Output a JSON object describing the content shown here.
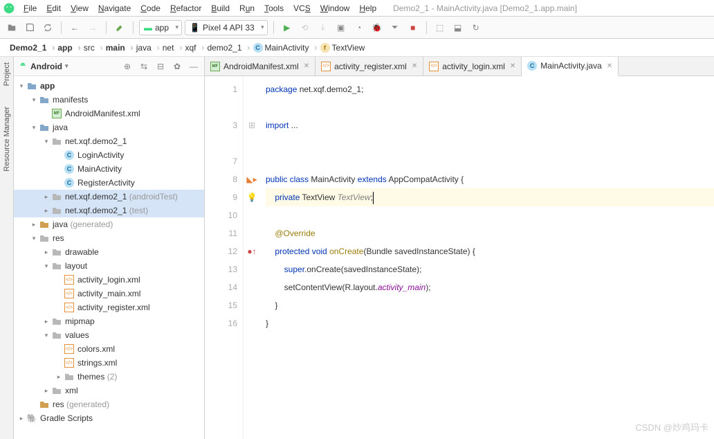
{
  "window_title": "Demo2_1 - MainActivity.java [Demo2_1.app.main]",
  "menu": [
    "File",
    "Edit",
    "View",
    "Navigate",
    "Code",
    "Refactor",
    "Build",
    "Run",
    "Tools",
    "VCS",
    "Window",
    "Help"
  ],
  "toolbar": {
    "module": "app",
    "device": "Pixel 4 API 33"
  },
  "breadcrumb": [
    {
      "label": "Demo2_1",
      "bold": true
    },
    {
      "label": "app",
      "bold": true
    },
    {
      "label": "src"
    },
    {
      "label": "main",
      "bold": true
    },
    {
      "label": "java"
    },
    {
      "label": "net"
    },
    {
      "label": "xqf"
    },
    {
      "label": "demo2_1"
    },
    {
      "label": "MainActivity",
      "icon": "c"
    },
    {
      "label": "TextView",
      "icon": "f"
    }
  ],
  "leftrail": [
    "Project",
    "Resource Manager"
  ],
  "sidebar": {
    "view_label": "Android",
    "tree": {
      "app": "app",
      "manifests": "manifests",
      "androidmanifest": "AndroidManifest.xml",
      "java": "java",
      "pkg_main": "net.xqf.demo2_1",
      "LoginActivity": "LoginActivity",
      "MainActivity": "MainActivity",
      "RegisterActivity": "RegisterActivity",
      "pkg_androidtest": "net.xqf.demo2_1",
      "pkg_androidtest_hint": "(androidTest)",
      "pkg_test": "net.xqf.demo2_1",
      "pkg_test_hint": "(test)",
      "java_gen": "java",
      "java_gen_hint": "(generated)",
      "res": "res",
      "drawable": "drawable",
      "layout": "layout",
      "activity_login": "activity_login.xml",
      "activity_main": "activity_main.xml",
      "activity_register": "activity_register.xml",
      "mipmap": "mipmap",
      "values": "values",
      "colors": "colors.xml",
      "strings": "strings.xml",
      "themes": "themes",
      "themes_hint": "(2)",
      "xml": "xml",
      "res_gen": "res",
      "res_gen_hint": "(generated)",
      "gradle": "Gradle Scripts"
    }
  },
  "tabs": [
    {
      "label": "AndroidManifest.xml",
      "icon": "mf"
    },
    {
      "label": "activity_register.xml",
      "icon": "xml"
    },
    {
      "label": "activity_login.xml",
      "icon": "xml"
    },
    {
      "label": "MainActivity.java",
      "icon": "c",
      "active": true
    }
  ],
  "code": {
    "line_numbers": [
      "1",
      "",
      "3",
      "",
      "7",
      "8",
      "9",
      "10",
      "11",
      "12",
      "13",
      "14",
      "15",
      "16"
    ],
    "l1_kw": "package",
    "l1_rest": " net.xqf.demo2_1;",
    "l3_kw": "import",
    "l3_rest": " ...",
    "l8_public": "public ",
    "l8_class": "class ",
    "l8_name": "MainActivity ",
    "l8_ext": "extends ",
    "l8_sup": "AppCompatActivity {",
    "l9_priv": "private ",
    "l9_type": "TextView ",
    "l9_var": "TextView",
    "l9_semi": ";",
    "l11_ann": "@Override",
    "l12_prot": "protected ",
    "l12_void": "void ",
    "l12_name": "onCreate",
    "l12_sig": "(Bundle savedInstanceState) {",
    "l13_a": "super",
    "l13_b": ".onCreate(savedInstanceState);",
    "l14_a": "setContentView(R.layout.",
    "l14_b": "activity_main",
    "l14_c": ");",
    "l15": "}",
    "l16": "}"
  },
  "watermark": "CSDN @炒鸡玛卡"
}
